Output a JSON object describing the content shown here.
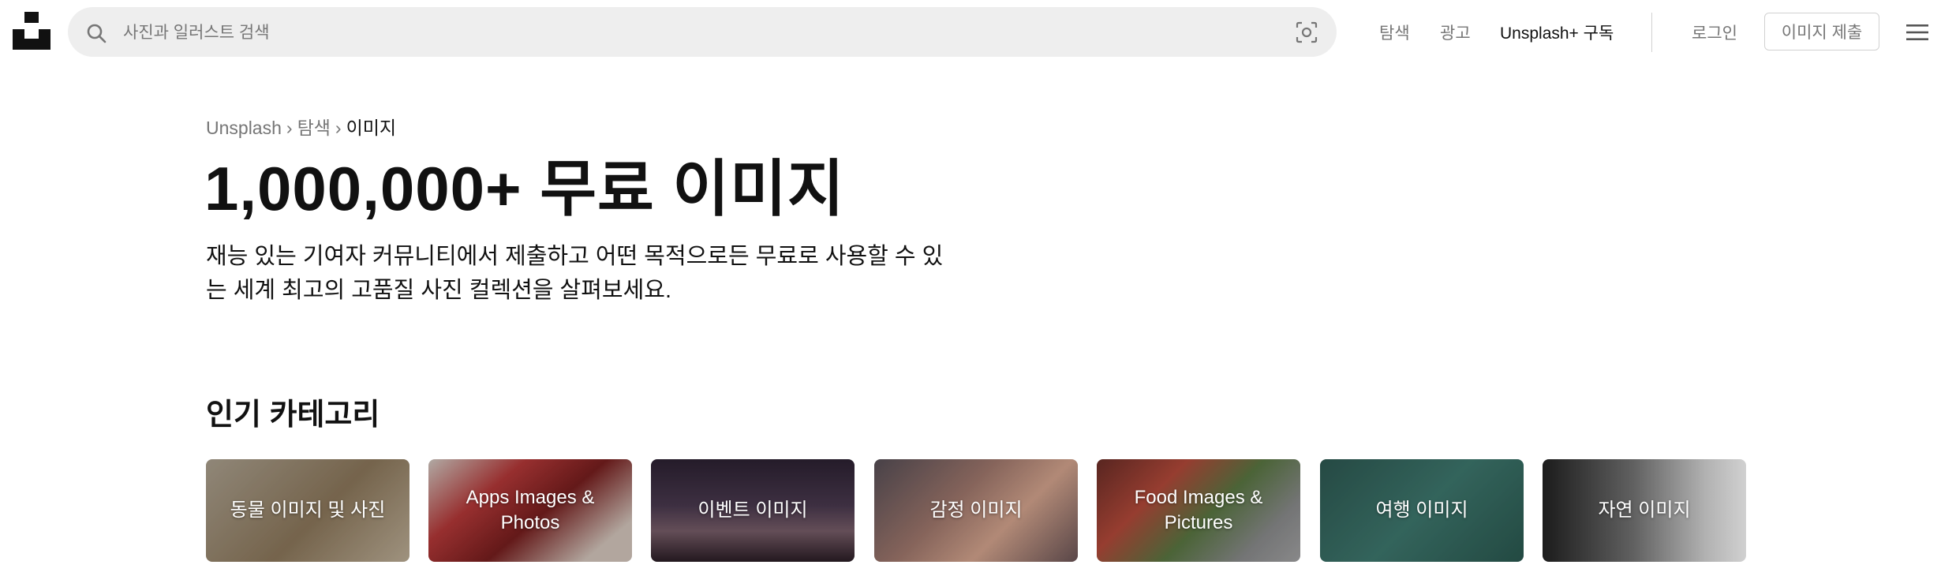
{
  "header": {
    "search_placeholder": "사진과 일러스트 검색",
    "nav": {
      "explore": "탐색",
      "ads": "광고",
      "plus": "Unsplash+ 구독",
      "login": "로그인"
    },
    "submit_label": "이미지 제출",
    "icons": {
      "logo": "unsplash-logo-icon",
      "search": "search-icon",
      "visual_search": "visual-search-icon",
      "menu": "hamburger-menu-icon"
    }
  },
  "breadcrumb": {
    "home": "Unsplash",
    "sep": "›",
    "explore": "탐색",
    "current": "이미지"
  },
  "hero": {
    "title": "1,000,000+ 무료 이미지",
    "subtitle": "재능 있는 기여자 커뮤니티에서 제출하고 어떤 목적으로든 무료로 사용할 수 있는 세계 최고의 고품질 사진 컬렉션을 살펴보세요."
  },
  "categories": {
    "heading": "인기 카테고리",
    "items": [
      {
        "label": "동물 이미지 및 사진"
      },
      {
        "label": "Apps Images & Photos"
      },
      {
        "label": "이벤트 이미지"
      },
      {
        "label": "감정 이미지"
      },
      {
        "label": "Food Images & Pictures"
      },
      {
        "label": "여행 이미지"
      },
      {
        "label": "자연 이미지"
      }
    ]
  },
  "colors": {
    "text": "#111111",
    "muted": "#767676",
    "search_bg": "#eeeeee",
    "border": "#d1d1d1"
  }
}
